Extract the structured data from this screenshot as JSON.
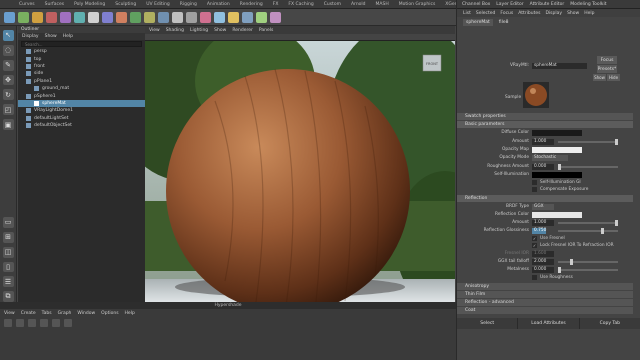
{
  "shelf": {
    "tabs": [
      "Curves",
      "Surfaces",
      "Poly Modeling",
      "Sculpting",
      "UV Editing",
      "Rigging",
      "Animation",
      "Rendering",
      "FX",
      "FX Caching",
      "Custom",
      "Arnold",
      "MASH",
      "Motion Graphics",
      "XGen",
      "VRay",
      "Bifrost"
    ],
    "active_index": 16
  },
  "outliner": {
    "title": "Outliner",
    "menu": [
      "Display",
      "Show",
      "Help"
    ],
    "search_placeholder": "Search...",
    "items": [
      {
        "label": "persp",
        "indent": 1,
        "selected": false
      },
      {
        "label": "top",
        "indent": 1,
        "selected": false
      },
      {
        "label": "front",
        "indent": 1,
        "selected": false
      },
      {
        "label": "side",
        "indent": 1,
        "selected": false
      },
      {
        "label": "pPlane1",
        "indent": 1,
        "selected": false
      },
      {
        "label": "ground_mat",
        "indent": 2,
        "selected": false
      },
      {
        "label": "pSphere1",
        "indent": 1,
        "selected": false
      },
      {
        "label": "sphereMat",
        "indent": 2,
        "selected": true
      },
      {
        "label": "VRayLightDome1",
        "indent": 1,
        "selected": false
      },
      {
        "label": "defaultLightSet",
        "indent": 1,
        "selected": false
      },
      {
        "label": "defaultObjectSet",
        "indent": 1,
        "selected": false
      }
    ]
  },
  "viewport": {
    "menu": [
      "View",
      "Shading",
      "Lighting",
      "Show",
      "Renderer",
      "Panels"
    ],
    "cube_label": "FRONT"
  },
  "attribute_editor": {
    "tabs": [
      "Channel Box",
      "Layer Editor",
      "Attribute Editor",
      "Modeling Toolkit"
    ],
    "menu": [
      "List",
      "Selected",
      "Focus",
      "Attributes",
      "Display",
      "Show",
      "Help"
    ],
    "node_tabs": [
      "sphereMat",
      "file8"
    ],
    "node_type_label": "VRayMtl:",
    "node_name": "sphereMat",
    "focus_button": "Focus",
    "presets_button": "Presets*",
    "show_button": "Show",
    "hide_button": "Hide",
    "sample_label": "Sample",
    "sections": {
      "swatch": "Swatch properties",
      "basic": "Basic parameters",
      "reflection": "Reflection",
      "anisotropy": "Anisotropy",
      "thin_film": "Thin Film",
      "refl_adv": "Reflection - advanced",
      "coat": "Coat"
    },
    "basic": {
      "diffuse_color_label": "Diffuse Color",
      "amount_label": "Amount",
      "amount_value": "1.000",
      "opacity_map_label": "Opacity Map",
      "opacity_mode_label": "Opacity Mode",
      "opacity_mode_value": "Stochastic",
      "roughness_label": "Roughness Amount",
      "roughness_value": "0.000",
      "self_illum_label": "Self-Illumination",
      "self_illum_gi": "Self-Illumination GI",
      "compensate_exposure": "Compensate Exposure"
    },
    "reflection": {
      "brdf_type_label": "BRDF Type",
      "brdf_type_value": "GGX",
      "refl_color_label": "Reflection Color",
      "amount_label": "Amount",
      "amount_value": "1.000",
      "glossiness_label": "Reflection Glossiness",
      "glossiness_value": "0.750",
      "use_fresnel": "Use Fresnel",
      "lock_fresnel": "Lock Fresnel IOR To Refraction IOR",
      "fresnel_ior_label": "Fresnel IOR",
      "fresnel_ior_value": "1.600",
      "ggx_tail_label": "GGX tail falloff",
      "ggx_tail_value": "2.000",
      "metalness_label": "Metalness",
      "metalness_value": "0.000",
      "use_roughness": "Use Roughness"
    },
    "bottom_buttons": [
      "Select",
      "Load Attributes",
      "Copy Tab"
    ],
    "colors": {
      "accent": "#5285a6",
      "diffuse_swatch": "#1a1a1a",
      "refl_swatch": "#e6e6e6"
    }
  },
  "hypershade": {
    "title": "Hypershade",
    "menu": [
      "View",
      "Create",
      "Tabs",
      "Graph",
      "Window",
      "Options",
      "Help"
    ]
  }
}
